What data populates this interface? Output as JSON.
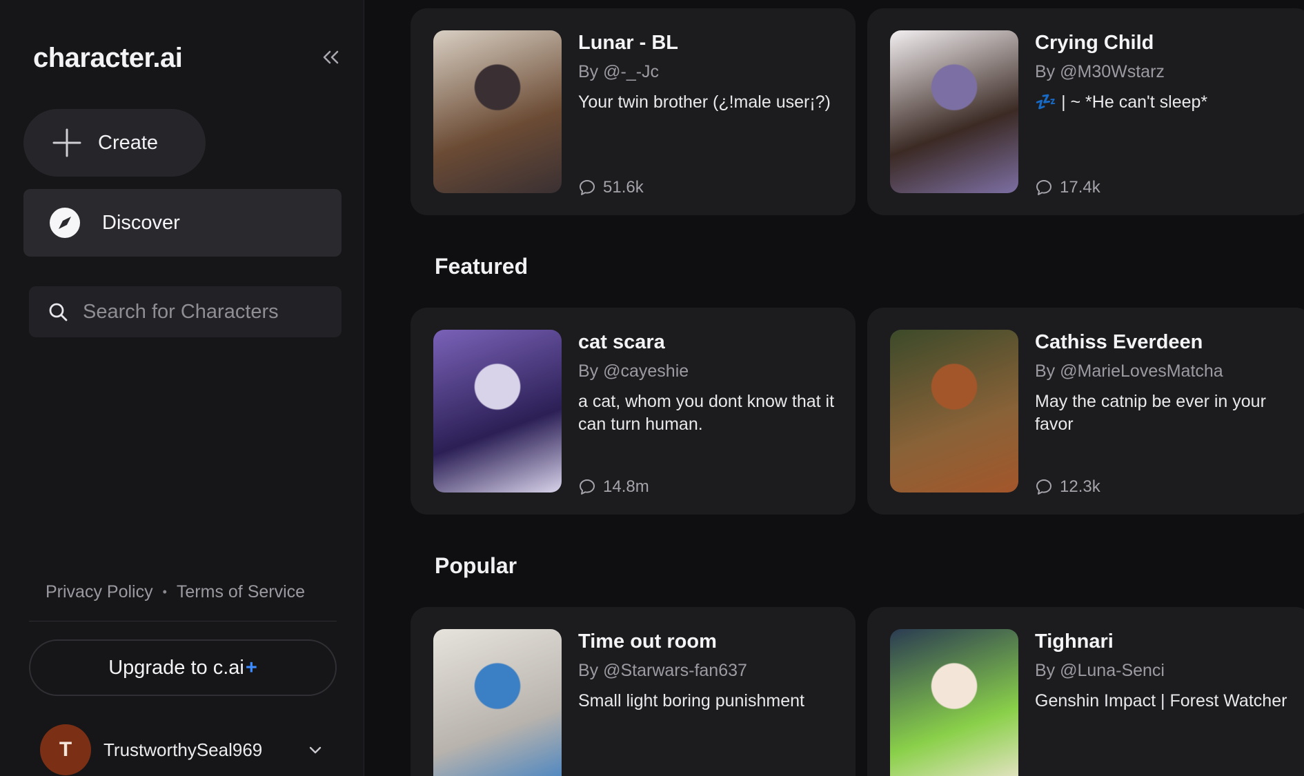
{
  "sidebar": {
    "logo": "character.ai",
    "create_label": "Create",
    "discover_label": "Discover",
    "search_placeholder": "Search for Characters",
    "privacy": "Privacy Policy",
    "separator": "•",
    "terms": "Terms of Service",
    "upgrade_label": "Upgrade to c.ai",
    "upgrade_plus": "+",
    "user": {
      "initial": "T",
      "name": "TrustworthySeal969"
    }
  },
  "sections": {
    "featured": "Featured",
    "popular": "Popular"
  },
  "cards": [
    {
      "name": "Lunar - BL",
      "author": "By @-_-Jc",
      "desc": "Your twin brother (¿!male user¡?)",
      "count": "51.6k",
      "colors": [
        "#d8cfc3",
        "#6b4b34",
        "#3a3033"
      ]
    },
    {
      "name": "Crying Child",
      "author": "By @M30Wstarz",
      "desc": "💤 | ~ *He can't sleep*",
      "count": "17.4k",
      "colors": [
        "#f2eef0",
        "#3b2a24",
        "#7c6fa3"
      ]
    },
    {
      "name": "cat scara",
      "author": "By @cayeshie",
      "desc": "a cat, whom you dont know that it can turn human.",
      "count": "14.8m",
      "colors": [
        "#7a62b8",
        "#2b1f55",
        "#d9d3ea"
      ]
    },
    {
      "name": "Cathiss Everdeen",
      "author": "By @MarieLovesMatcha",
      "desc": "May the catnip be ever in your favor",
      "count": "12.3k",
      "colors": [
        "#3c4a2a",
        "#8a6238",
        "#a3562a"
      ]
    },
    {
      "name": "Time out room",
      "author": "By @Starwars-fan637",
      "desc": "Small light boring punishment",
      "count": "",
      "colors": [
        "#e6e2dc",
        "#b8b3ad",
        "#3b7fc4"
      ]
    },
    {
      "name": "Tighnari",
      "author": "By @Luna-Senci",
      "desc": "Genshin Impact | Forest Watcher",
      "count": "",
      "colors": [
        "#2a3b52",
        "#8ad04a",
        "#f3e6d8"
      ]
    }
  ]
}
